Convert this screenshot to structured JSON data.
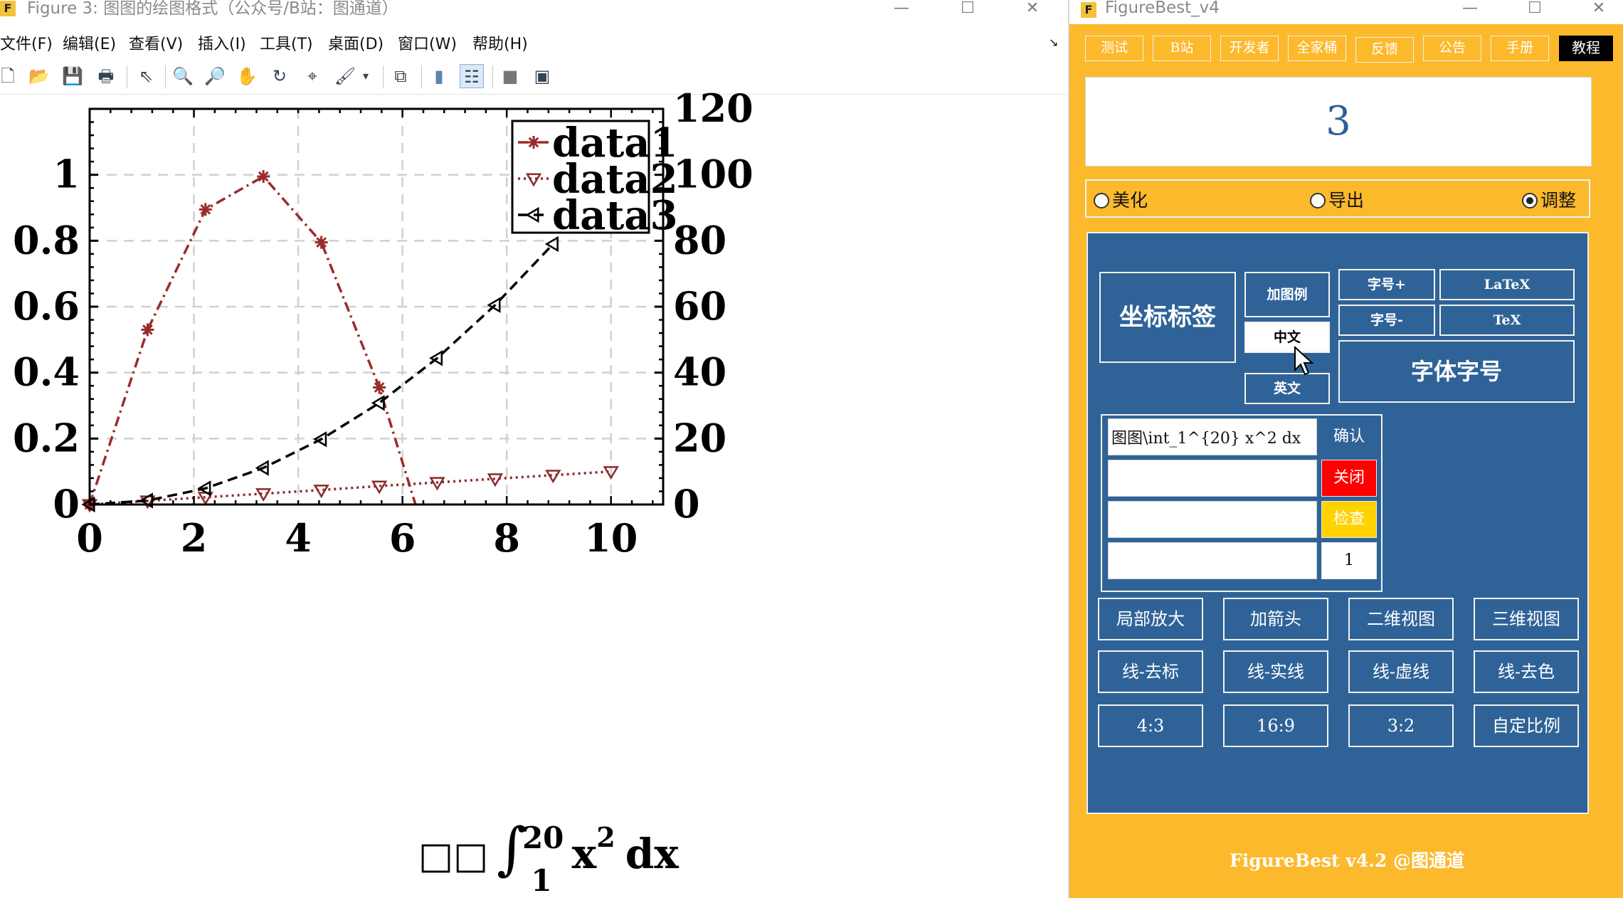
{
  "figure_window": {
    "title": "Figure 3: 图图的绘图格式（公众号/B站：图通道）",
    "controls": {
      "minimize": "—",
      "maximize": "☐",
      "close": "✕"
    },
    "menu": [
      "文件(F)",
      "编辑(E)",
      "查看(V)",
      "插入(I)",
      "工具(T)",
      "桌面(D)",
      "窗口(W)",
      "帮助(H)"
    ],
    "menu_arrow": "↘",
    "toolbar": [
      {
        "name": "new-file-icon",
        "glyph": "🗋"
      },
      {
        "name": "open-folder-icon",
        "glyph": "📂"
      },
      {
        "name": "save-icon",
        "glyph": "💾"
      },
      {
        "name": "print-icon",
        "glyph": "🖶"
      },
      {
        "name": "pointer-icon",
        "glyph": "⇖"
      },
      {
        "name": "zoom-in-icon",
        "glyph": "🔍"
      },
      {
        "name": "zoom-out-icon",
        "glyph": "🔎"
      },
      {
        "name": "pan-hand-icon",
        "glyph": "✋"
      },
      {
        "name": "rotate-3d-icon",
        "glyph": "↻"
      },
      {
        "name": "data-cursor-icon",
        "glyph": "⌖"
      },
      {
        "name": "brush-icon",
        "glyph": "🖌"
      },
      {
        "name": "brush-dropdown-icon",
        "glyph": "▾"
      },
      {
        "name": "link-plot-icon",
        "glyph": "⧉"
      },
      {
        "name": "colorbar-icon",
        "glyph": "▮"
      },
      {
        "name": "legend-icon",
        "glyph": "☷"
      },
      {
        "name": "hide-plot-tools-icon",
        "glyph": "■"
      },
      {
        "name": "show-plot-tools-icon",
        "glyph": "▣"
      }
    ]
  },
  "chart_data": {
    "type": "line",
    "xlabel_parts": [
      "□□",
      "∫",
      "20",
      "1",
      "x",
      "2",
      "dx"
    ],
    "xlim": [
      0,
      11
    ],
    "ylim_left": [
      0,
      1.2
    ],
    "ylim_right": [
      0,
      120
    ],
    "x_ticks": [
      0,
      2,
      4,
      6,
      8,
      10
    ],
    "x_tick_labels": [
      "0",
      "2",
      "4",
      "6",
      "8",
      "10"
    ],
    "y_left_ticks": [
      0,
      0.2,
      0.4,
      0.6,
      0.8,
      1
    ],
    "y_left_tick_labels": [
      "0",
      "0.2",
      "0.4",
      "0.6",
      "0.8",
      "1"
    ],
    "y_right_ticks": [
      0,
      20,
      40,
      60,
      80,
      100,
      120
    ],
    "y_right_tick_labels": [
      "0",
      "20",
      "40",
      "60",
      "80",
      "100",
      "120"
    ],
    "grid": true,
    "legend_position": "top-right",
    "series": [
      {
        "name": "data1",
        "axis": "left",
        "color": "#9b2b2b",
        "marker": "asterisk",
        "line": "dashdot",
        "x": [
          0,
          1.111,
          2.222,
          3.333,
          4.444,
          5.556,
          6.25
        ],
        "y": [
          0,
          0.53,
          0.895,
          0.995,
          0.795,
          0.355,
          0
        ]
      },
      {
        "name": "data2",
        "axis": "left",
        "color": "#8e2a2a",
        "marker": "triangle-down",
        "line": "dotted",
        "x": [
          0,
          1.111,
          2.222,
          3.333,
          4.444,
          5.556,
          6.667,
          7.778,
          8.889,
          10
        ],
        "y": [
          0,
          0.011,
          0.022,
          0.033,
          0.044,
          0.056,
          0.067,
          0.078,
          0.089,
          0.1
        ]
      },
      {
        "name": "data3",
        "axis": "right",
        "color": "#000000",
        "marker": "triangle-left",
        "line": "dashed",
        "x": [
          0,
          1.111,
          2.222,
          3.333,
          4.444,
          5.556,
          6.667,
          7.778,
          8.889
        ],
        "y": [
          0,
          1.2,
          4.9,
          11.1,
          19.8,
          30.8,
          44.4,
          60.5,
          79.0
        ]
      }
    ]
  },
  "figurebest": {
    "title": "FigureBest_v4",
    "controls": {
      "minimize": "—",
      "maximize": "☐",
      "close": "✕"
    },
    "top_buttons": [
      "测试",
      "B站",
      "开发者",
      "全家桶",
      "反馈",
      "公告",
      "手册",
      "教程"
    ],
    "display_value": "3",
    "radio": [
      {
        "label": "美化",
        "checked": false
      },
      {
        "label": "导出",
        "checked": false
      },
      {
        "label": "调整",
        "checked": true
      }
    ],
    "axis_label_button": "坐标标签",
    "add_legend_button": "加图例",
    "chinese_button": "中文",
    "english_button": "英文",
    "font_up_button": "字号+",
    "font_down_button": "字号-",
    "latex_button": "LaTeX",
    "tex_button": "TeX",
    "font_size_button": "字体字号",
    "inputs": [
      "图图\\int_1^{20} x^2 dx",
      "",
      "",
      ""
    ],
    "confirm_button": "确认",
    "close_button": "关闭",
    "check_button": "检查",
    "counter_value": "1",
    "grid_buttons": [
      [
        "局部放大",
        "加箭头",
        "二维视图",
        "三维视图"
      ],
      [
        "线-去标",
        "线-实线",
        "线-虚线",
        "线-去色"
      ],
      [
        "4:3",
        "16:9",
        "3:2",
        "自定比例"
      ]
    ],
    "footer": "FigureBest v4.2 @图通道",
    "colors": {
      "background": "#fcb92c",
      "panel": "#2f6398",
      "close": "#ff0000",
      "check": "#ffd200"
    }
  }
}
